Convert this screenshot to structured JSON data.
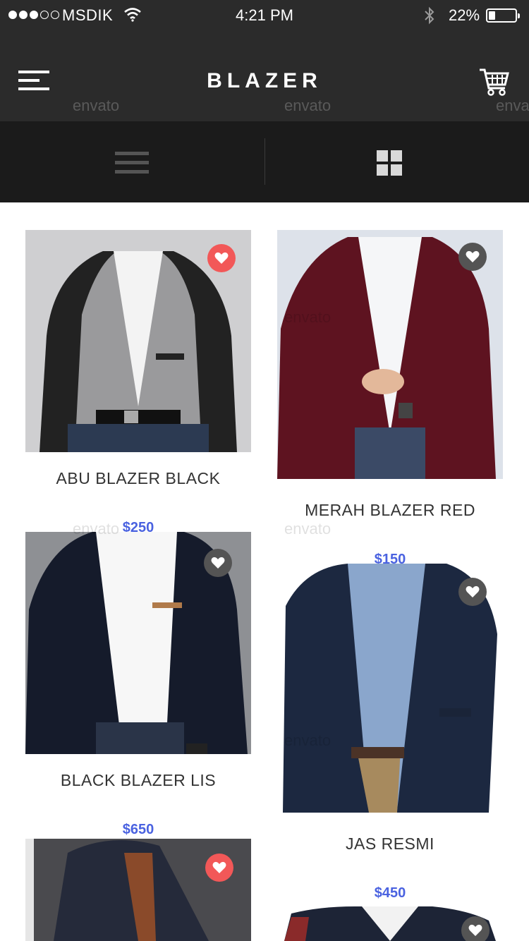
{
  "status_bar": {
    "carrier": "MSDIK",
    "time": "4:21 PM",
    "battery": "22%"
  },
  "header": {
    "title": "BLAZER",
    "watermark": "envato"
  },
  "view_toggle": {
    "active": "grid"
  },
  "products": [
    {
      "name": "ABU BLAZER BLACK",
      "price": "$250",
      "favorite": true
    },
    {
      "name": "MERAH BLAZER RED",
      "price": "$150",
      "favorite": false
    },
    {
      "name": "BLACK BLAZER LIS",
      "price": "$650",
      "favorite": false
    },
    {
      "name": "JAS RESMI",
      "price": "$450",
      "favorite": false
    },
    {
      "name": "",
      "price": "",
      "favorite": true
    },
    {
      "name": "",
      "price": "",
      "favorite": false
    }
  ],
  "colors": {
    "header_bg": "#2b2b2b",
    "toggle_bg": "#1b1b1b",
    "price": "#4a62e0",
    "favorite_on": "#f25858",
    "favorite_off": "#545454"
  }
}
